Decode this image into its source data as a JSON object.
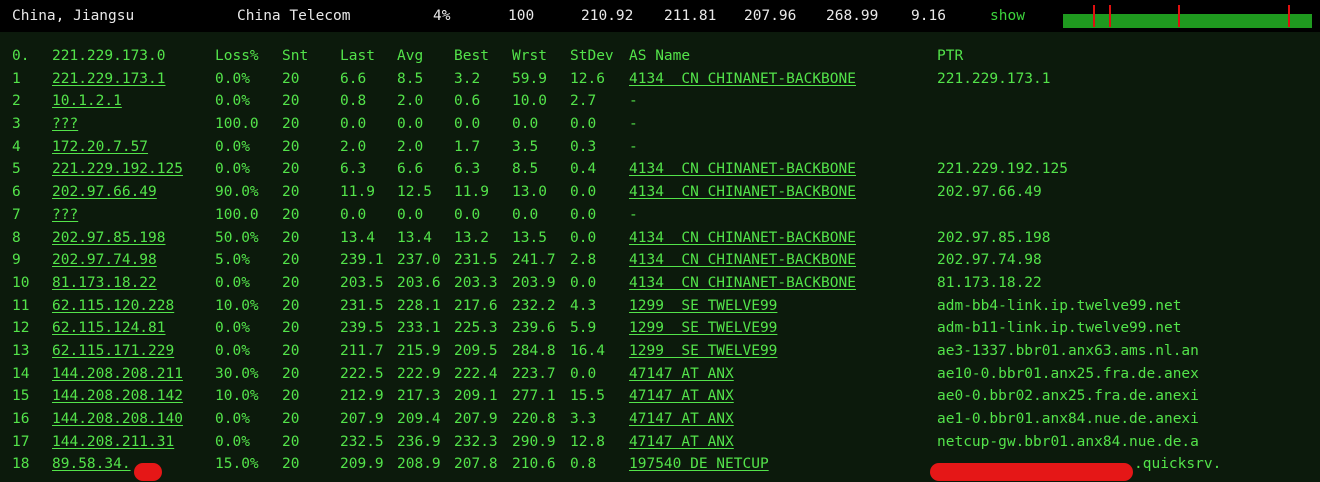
{
  "summary": {
    "location": "China, Jiangsu",
    "isp": "China Telecom",
    "loss": "4%",
    "sent": "100",
    "last": "210.92",
    "avg": "211.81",
    "best": "207.96",
    "worst": "268.99",
    "stdev": "9.16",
    "show_label": "show"
  },
  "graph": {
    "fill_color": "#1f9a1f",
    "spike_color": "#e01010"
  },
  "table": {
    "headers": {
      "idx": "0.",
      "host": "221.229.173.0",
      "loss": "Loss%",
      "snt": "Snt",
      "last": "Last",
      "avg": "Avg",
      "best": "Best",
      "wrst": "Wrst",
      "stdev": "StDev",
      "as": "AS Name",
      "ptr": "PTR"
    },
    "rows": [
      {
        "idx": "1",
        "host": "221.229.173.1",
        "loss": "0.0%",
        "snt": "20",
        "last": "6.6",
        "avg": "8.5",
        "best": "3.2",
        "wrst": "59.9",
        "stdev": "12.6",
        "as": "4134  CN CHINANET-BACKBONE",
        "ptr": "221.229.173.1"
      },
      {
        "idx": "2",
        "host": "10.1.2.1",
        "loss": "0.0%",
        "snt": "20",
        "last": "0.8",
        "avg": "2.0",
        "best": "0.6",
        "wrst": "10.0",
        "stdev": "2.7",
        "as": "-",
        "ptr": ""
      },
      {
        "idx": "3",
        "host": "???",
        "loss": "100.0",
        "snt": "20",
        "last": "0.0",
        "avg": "0.0",
        "best": "0.0",
        "wrst": "0.0",
        "stdev": "0.0",
        "as": "-",
        "ptr": ""
      },
      {
        "idx": "4",
        "host": "172.20.7.57",
        "loss": "0.0%",
        "snt": "20",
        "last": "2.0",
        "avg": "2.0",
        "best": "1.7",
        "wrst": "3.5",
        "stdev": "0.3",
        "as": "-",
        "ptr": ""
      },
      {
        "idx": "5",
        "host": "221.229.192.125",
        "loss": "0.0%",
        "snt": "20",
        "last": "6.3",
        "avg": "6.6",
        "best": "6.3",
        "wrst": "8.5",
        "stdev": "0.4",
        "as": "4134  CN CHINANET-BACKBONE",
        "ptr": "221.229.192.125"
      },
      {
        "idx": "6",
        "host": "202.97.66.49",
        "loss": "90.0%",
        "snt": "20",
        "last": "11.9",
        "avg": "12.5",
        "best": "11.9",
        "wrst": "13.0",
        "stdev": "0.0",
        "as": "4134  CN CHINANET-BACKBONE",
        "ptr": "202.97.66.49"
      },
      {
        "idx": "7",
        "host": "???",
        "loss": "100.0",
        "snt": "20",
        "last": "0.0",
        "avg": "0.0",
        "best": "0.0",
        "wrst": "0.0",
        "stdev": "0.0",
        "as": "-",
        "ptr": ""
      },
      {
        "idx": "8",
        "host": "202.97.85.198",
        "loss": "50.0%",
        "snt": "20",
        "last": "13.4",
        "avg": "13.4",
        "best": "13.2",
        "wrst": "13.5",
        "stdev": "0.0",
        "as": "4134  CN CHINANET-BACKBONE",
        "ptr": "202.97.85.198"
      },
      {
        "idx": "9",
        "host": "202.97.74.98",
        "loss": "5.0%",
        "snt": "20",
        "last": "239.1",
        "avg": "237.0",
        "best": "231.5",
        "wrst": "241.7",
        "stdev": "2.8",
        "as": "4134  CN CHINANET-BACKBONE",
        "ptr": "202.97.74.98"
      },
      {
        "idx": "10",
        "host": "81.173.18.22",
        "loss": "0.0%",
        "snt": "20",
        "last": "203.5",
        "avg": "203.6",
        "best": "203.3",
        "wrst": "203.9",
        "stdev": "0.0",
        "as": "4134  CN CHINANET-BACKBONE",
        "ptr": "81.173.18.22"
      },
      {
        "idx": "11",
        "host": "62.115.120.228",
        "loss": "10.0%",
        "snt": "20",
        "last": "231.5",
        "avg": "228.1",
        "best": "217.6",
        "wrst": "232.2",
        "stdev": "4.3",
        "as": "1299  SE TWELVE99",
        "ptr": "adm-bb4-link.ip.twelve99.net"
      },
      {
        "idx": "12",
        "host": "62.115.124.81",
        "loss": "0.0%",
        "snt": "20",
        "last": "239.5",
        "avg": "233.1",
        "best": "225.3",
        "wrst": "239.6",
        "stdev": "5.9",
        "as": "1299  SE TWELVE99",
        "ptr": "adm-b11-link.ip.twelve99.net"
      },
      {
        "idx": "13",
        "host": "62.115.171.229",
        "loss": "0.0%",
        "snt": "20",
        "last": "211.7",
        "avg": "215.9",
        "best": "209.5",
        "wrst": "284.8",
        "stdev": "16.4",
        "as": "1299  SE TWELVE99",
        "ptr": "ae3-1337.bbr01.anx63.ams.nl.an"
      },
      {
        "idx": "14",
        "host": "144.208.208.211",
        "loss": "30.0%",
        "snt": "20",
        "last": "222.5",
        "avg": "222.9",
        "best": "222.4",
        "wrst": "223.7",
        "stdev": "0.0",
        "as": "47147 AT ANX",
        "ptr": "ae10-0.bbr01.anx25.fra.de.anex"
      },
      {
        "idx": "15",
        "host": "144.208.208.142",
        "loss": "10.0%",
        "snt": "20",
        "last": "212.9",
        "avg": "217.3",
        "best": "209.1",
        "wrst": "277.1",
        "stdev": "15.5",
        "as": "47147 AT ANX",
        "ptr": "ae0-0.bbr02.anx25.fra.de.anexi"
      },
      {
        "idx": "16",
        "host": "144.208.208.140",
        "loss": "0.0%",
        "snt": "20",
        "last": "207.9",
        "avg": "209.4",
        "best": "207.9",
        "wrst": "220.8",
        "stdev": "3.3",
        "as": "47147 AT ANX",
        "ptr": "ae1-0.bbr01.anx84.nue.de.anexi"
      },
      {
        "idx": "17",
        "host": "144.208.211.31",
        "loss": "0.0%",
        "snt": "20",
        "last": "232.5",
        "avg": "236.9",
        "best": "232.3",
        "wrst": "290.9",
        "stdev": "12.8",
        "as": "47147 AT ANX",
        "ptr": "netcup-gw.bbr01.anx84.nue.de.a"
      },
      {
        "idx": "18",
        "host": "89.58.34.",
        "loss": "15.0%",
        "snt": "20",
        "last": "209.9",
        "avg": "208.9",
        "best": "207.8",
        "wrst": "210.6",
        "stdev": "0.8",
        "as": "197540 DE NETCUP",
        "ptr": ".quicksrv."
      }
    ]
  }
}
